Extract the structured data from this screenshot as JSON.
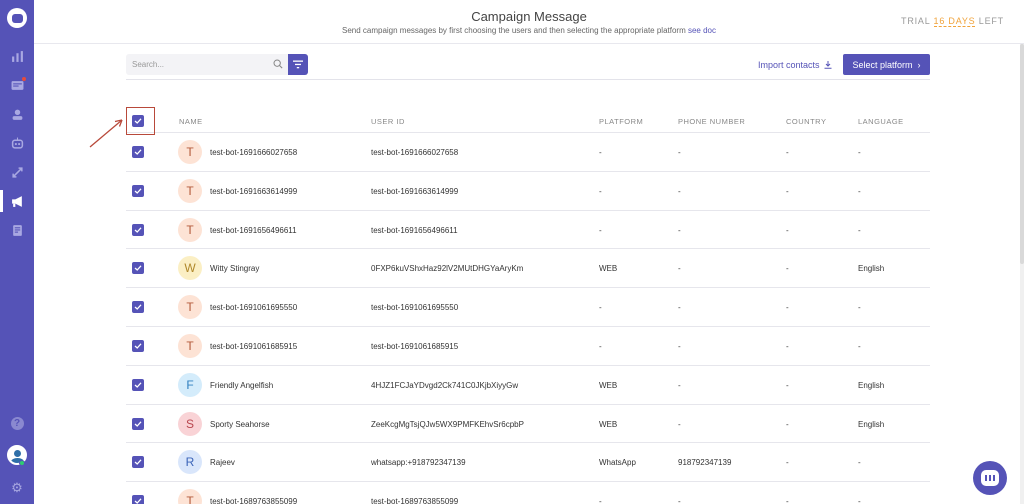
{
  "header": {
    "title": "Campaign Message",
    "subtitle": "Send campaign messages by first choosing the users and then selecting the appropriate platform",
    "subtitle_link": "see doc",
    "trial_prefix": "TRIAL",
    "trial_days": "16 DAYS",
    "trial_suffix": "LEFT"
  },
  "toolbar": {
    "search_placeholder": "Search...",
    "import_label": "Import contacts",
    "select_platform_label": "Select platform"
  },
  "table": {
    "columns": [
      "NAME",
      "USER ID",
      "PLATFORM",
      "PHONE NUMBER",
      "COUNTRY",
      "LANGUAGE"
    ],
    "rows": [
      {
        "initial": "T",
        "name": "test-bot-1691666027658",
        "user_id": "test-bot-1691666027658",
        "platform": "-",
        "phone": "-",
        "country": "-",
        "language": "-"
      },
      {
        "initial": "T",
        "name": "test-bot-1691663614999",
        "user_id": "test-bot-1691663614999",
        "platform": "-",
        "phone": "-",
        "country": "-",
        "language": "-"
      },
      {
        "initial": "T",
        "name": "test-bot-1691656496611",
        "user_id": "test-bot-1691656496611",
        "platform": "-",
        "phone": "-",
        "country": "-",
        "language": "-"
      },
      {
        "initial": "W",
        "name": "Witty Stingray",
        "user_id": "0FXP6kuVShxHaz92lV2MUtDHGYaAryKm",
        "platform": "WEB",
        "phone": "-",
        "country": "-",
        "language": "English"
      },
      {
        "initial": "T",
        "name": "test-bot-1691061695550",
        "user_id": "test-bot-1691061695550",
        "platform": "-",
        "phone": "-",
        "country": "-",
        "language": "-"
      },
      {
        "initial": "T",
        "name": "test-bot-1691061685915",
        "user_id": "test-bot-1691061685915",
        "platform": "-",
        "phone": "-",
        "country": "-",
        "language": "-"
      },
      {
        "initial": "F",
        "name": "Friendly Angelfish",
        "user_id": "4HJZ1FCJaYDvgd2Ck741C0JKjbXiyyGw",
        "platform": "WEB",
        "phone": "-",
        "country": "-",
        "language": "English"
      },
      {
        "initial": "S",
        "name": "Sporty Seahorse",
        "user_id": "ZeeKcgMgTsjQJw5WX9PMFKEhvSr6cpbP",
        "platform": "WEB",
        "phone": "-",
        "country": "-",
        "language": "English"
      },
      {
        "initial": "R",
        "name": "Rajeev",
        "user_id": "whatsapp:+918792347139",
        "platform": "WhatsApp",
        "phone": "918792347139",
        "country": "-",
        "language": "-"
      },
      {
        "initial": "T",
        "name": "test-bot-1689763855099",
        "user_id": "test-bot-1689763855099",
        "platform": "-",
        "phone": "-",
        "country": "-",
        "language": "-"
      }
    ]
  },
  "colors": {
    "accent": "#5553b7",
    "trial_orange": "#f0a33b",
    "avatar_t": "#fde3d5",
    "avatar_w": "#fbefc4",
    "avatar_f": "#d4ecfb",
    "avatar_s": "#f9d3d6",
    "avatar_r": "#d9e6fb"
  },
  "icons": {
    "sidebar": [
      "chart-icon",
      "inbox-icon",
      "users-icon",
      "bot-icon",
      "integrations-icon",
      "campaign-icon",
      "docs-icon"
    ],
    "bottom": [
      "help-icon",
      "avatar",
      "gear-icon"
    ]
  }
}
